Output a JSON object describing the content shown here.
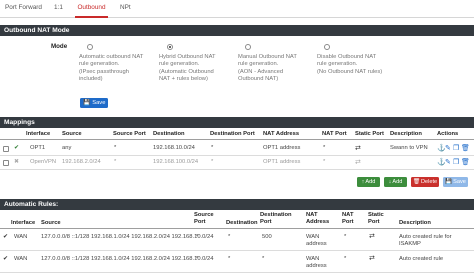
{
  "tabs": [
    {
      "label": "Port Forward"
    },
    {
      "label": "1:1"
    },
    {
      "label": "Outbound"
    },
    {
      "label": "NPt"
    }
  ],
  "nat_mode": {
    "heading": "Outbound NAT Mode",
    "mode_label": "Mode",
    "options": [
      {
        "lines": [
          "Automatic outbound NAT",
          "rule generation.",
          "(IPsec passthrough",
          "included)"
        ],
        "selected": false
      },
      {
        "lines": [
          "Hybrid Outbound NAT",
          "rule generation.",
          "(Automatic Outbound",
          "NAT + rules below)"
        ],
        "selected": true
      },
      {
        "lines": [
          "Manual Outbound NAT",
          "rule generation.",
          "(AON - Advanced",
          "Outbound NAT)"
        ],
        "selected": false
      },
      {
        "lines": [
          "Disable Outbound NAT",
          "rule generation.",
          "(No Outbound NAT rules)"
        ],
        "selected": false
      }
    ],
    "save_label": "Save"
  },
  "mappings": {
    "heading": "Mappings",
    "columns": [
      "Interface",
      "Source",
      "Source Port",
      "Destination",
      "Destination Port",
      "NAT Address",
      "NAT Port",
      "Static Port",
      "Description",
      "Actions"
    ],
    "rows": [
      {
        "enabled": true,
        "interface": "OPT1",
        "source": "any",
        "source_port": "*",
        "destination": "192.168.10.0/24",
        "destination_port": "*",
        "nat_address": "OPT1 address",
        "nat_port": "*",
        "description": "Swann to VPN"
      },
      {
        "enabled": false,
        "interface": "OpenVPN",
        "source": "192.168.2.0/24",
        "source_port": "*",
        "destination": "192.168.100.0/24",
        "destination_port": "*",
        "nat_address": "OPT1 address",
        "nat_port": "*",
        "description": ""
      }
    ],
    "buttons": {
      "add_top": "Add",
      "add_bottom": "Add",
      "delete": "Delete",
      "save": "Save"
    }
  },
  "auto_rules": {
    "heading": "Automatic Rules:",
    "columns": [
      "Interface",
      "Source",
      "Source Port",
      "Destination",
      "Destination Port",
      "NAT Address",
      "NAT Port",
      "Static Port",
      "Description"
    ],
    "rows": [
      {
        "interface": "WAN",
        "source": "127.0.0.0/8 ::1/128 192.168.1.0/24 192.168.2.0/24 192.168.10.0/24",
        "source_port": "*",
        "destination": "*",
        "destination_port": "500",
        "nat_address_lines": [
          "WAN",
          "address"
        ],
        "nat_port": "*",
        "description_lines": [
          "Auto created rule for",
          "ISAKMP"
        ]
      },
      {
        "interface": "WAN",
        "source": "127.0.0.0/8 ::1/128 192.168.1.0/24 192.168.2.0/24 192.168.10.0/24",
        "source_port": "*",
        "destination": "*",
        "destination_port": "*",
        "nat_address_lines": [
          "WAN",
          "address"
        ],
        "nat_port": "*",
        "description_lines": [
          "Auto created rule"
        ]
      }
    ]
  }
}
